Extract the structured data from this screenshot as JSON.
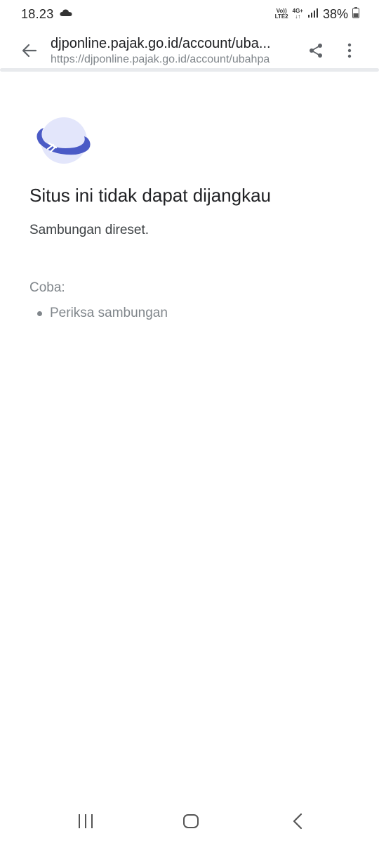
{
  "status_bar": {
    "time": "18.23",
    "volte_line1": "Vo))",
    "volte_line2": "LTE2",
    "network_type": "4G+",
    "battery": "38%"
  },
  "toolbar": {
    "page_title": "djponline.pajak.go.id/account/uba...",
    "url": "https://djponline.pajak.go.id/account/ubahpa",
    "icons": [
      "back-arrow-icon",
      "share-icon",
      "more-vert-icon"
    ]
  },
  "error": {
    "icon": "globe-unreachable-icon",
    "title": "Situs ini tidak dapat dijangkau",
    "description": "Sambungan direset.",
    "try_label": "Coba:",
    "suggestions": [
      "Periksa sambungan"
    ]
  },
  "nav_bar": {
    "icons": [
      "recent-apps-icon",
      "home-icon",
      "nav-back-icon"
    ]
  },
  "colors": {
    "globe_fill": "#e3e6fb",
    "ring": "#4a5ac6",
    "text_primary": "#202124",
    "text_secondary": "#80868b"
  }
}
